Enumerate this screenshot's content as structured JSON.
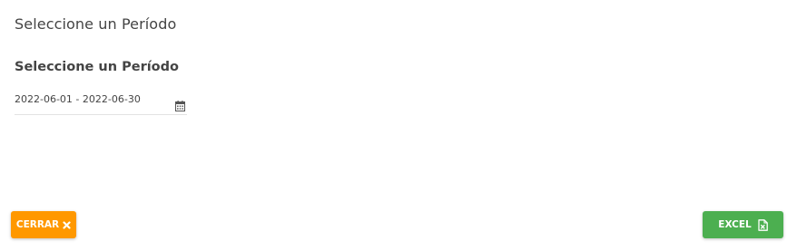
{
  "modal": {
    "title": "Seleccione un Período"
  },
  "period": {
    "label": "Seleccione un Período",
    "value": "2022-06-01 - 2022-06-30"
  },
  "buttons": {
    "close_label": "CERRAR",
    "excel_label": "EXCEL"
  },
  "icons": {
    "calendar": "calendar-icon",
    "close": "close-icon",
    "excel": "excel-file-icon"
  },
  "colors": {
    "close_button": "#ff9800",
    "excel_button": "#4caf50"
  }
}
